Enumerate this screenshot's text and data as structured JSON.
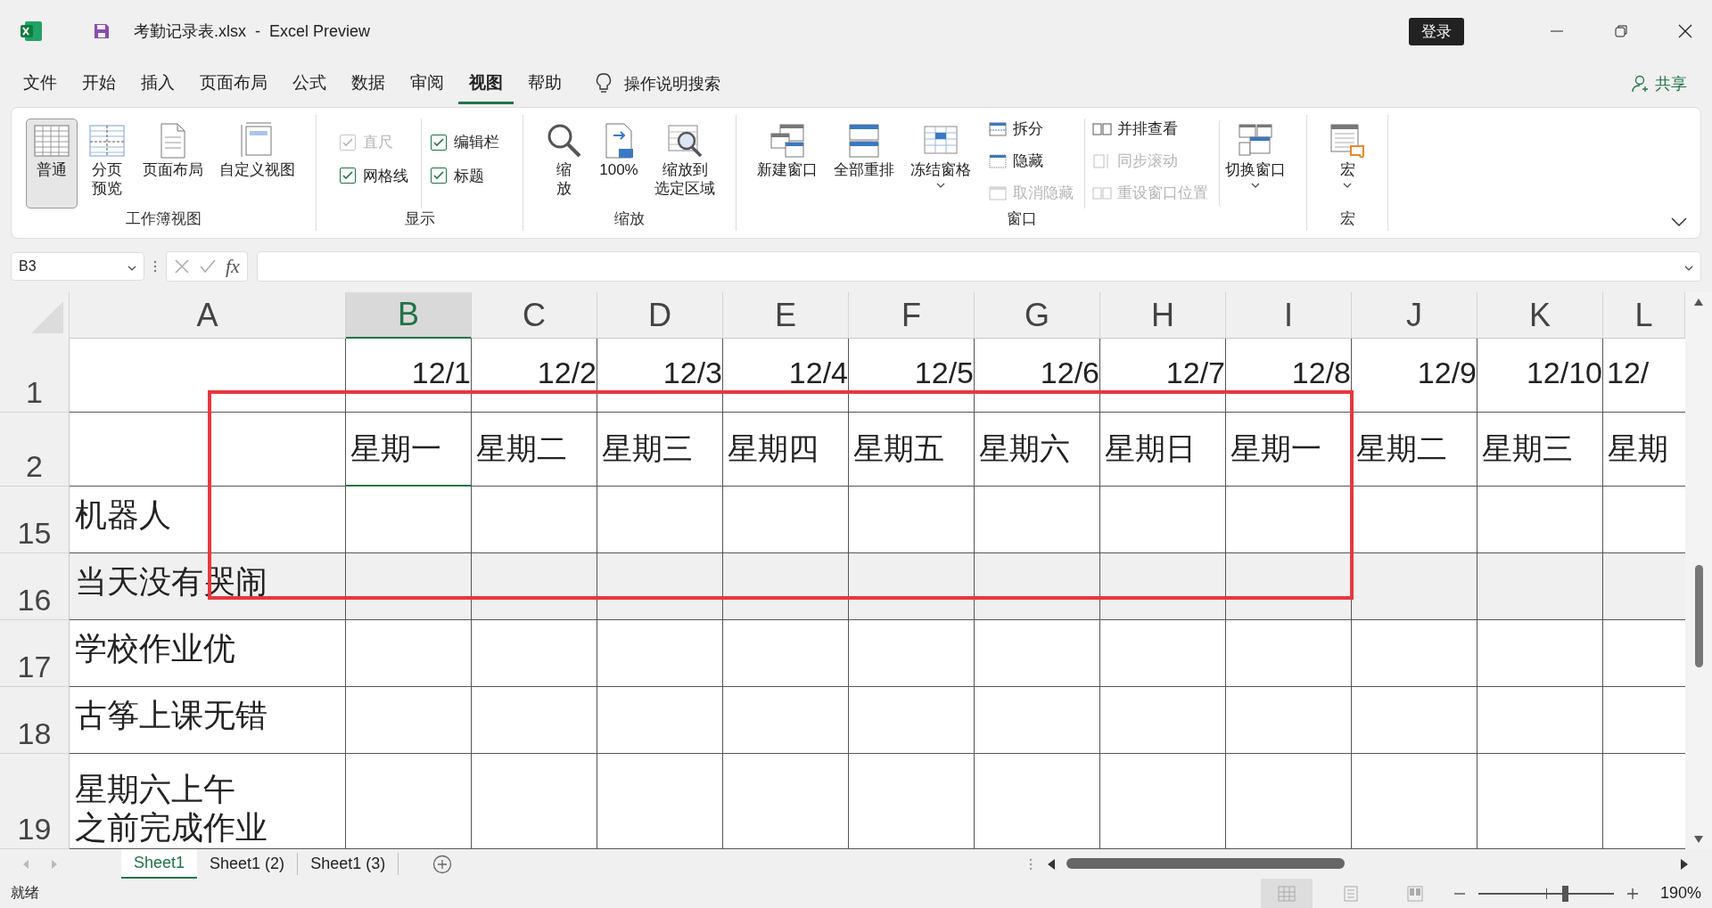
{
  "window": {
    "title": "考勤记录表.xlsx  -  Excel Preview",
    "sign_in": "登录"
  },
  "menu_tabs": [
    {
      "label": "文件",
      "selected": false
    },
    {
      "label": "开始",
      "selected": false
    },
    {
      "label": "插入",
      "selected": false
    },
    {
      "label": "页面布局",
      "selected": false
    },
    {
      "label": "公式",
      "selected": false
    },
    {
      "label": "数据",
      "selected": false
    },
    {
      "label": "审阅",
      "selected": false
    },
    {
      "label": "视图",
      "selected": true
    },
    {
      "label": "帮助",
      "selected": false
    }
  ],
  "search": {
    "placeholder": "操作说明搜索"
  },
  "share": "共享",
  "ribbon": {
    "groups": [
      {
        "label": "工作簿视图",
        "items": [
          {
            "kind": "large",
            "label": "普通",
            "selected": true
          },
          {
            "kind": "large",
            "label": "分页预览",
            "selected": false
          },
          {
            "kind": "large",
            "label": "页面布局",
            "selected": false
          },
          {
            "kind": "large",
            "label": "自定义视图",
            "selected": false
          }
        ]
      },
      {
        "label": "显示",
        "items": [
          {
            "kind": "stack",
            "items": [
              {
                "kind": "check",
                "label": "直尺",
                "checked": true,
                "disabled": true
              },
              {
                "kind": "check",
                "label": "网格线",
                "checked": true,
                "disabled": false
              }
            ]
          },
          {
            "kind": "stack",
            "items": [
              {
                "kind": "check",
                "label": "编辑栏",
                "checked": true,
                "disabled": false
              },
              {
                "kind": "check",
                "label": "标题",
                "checked": true,
                "disabled": false
              }
            ]
          }
        ]
      },
      {
        "label": "缩放",
        "items": [
          {
            "kind": "large",
            "label": "缩放"
          },
          {
            "kind": "large",
            "label": "100%"
          },
          {
            "kind": "large",
            "label": "缩放到选定区域"
          }
        ]
      },
      {
        "label": "窗口",
        "items": [
          {
            "kind": "large",
            "label": "新建窗口"
          },
          {
            "kind": "large",
            "label": "全部重排"
          },
          {
            "kind": "large",
            "label": "冻结窗格",
            "dropdown": true
          },
          {
            "kind": "stack",
            "items": [
              {
                "kind": "small",
                "label": "拆分",
                "disabled": false
              },
              {
                "kind": "small",
                "label": "隐藏",
                "disabled": false
              },
              {
                "kind": "small",
                "label": "取消隐藏",
                "disabled": true
              }
            ]
          },
          {
            "kind": "stack",
            "items": [
              {
                "kind": "small",
                "label": "并排查看",
                "disabled": false
              },
              {
                "kind": "small",
                "label": "同步滚动",
                "disabled": true
              },
              {
                "kind": "small",
                "label": "重设窗口位置",
                "disabled": true
              }
            ]
          },
          {
            "kind": "large",
            "label": "切换窗口",
            "dropdown": true
          }
        ]
      },
      {
        "label": "宏",
        "items": [
          {
            "kind": "large",
            "label": "宏",
            "dropdown": true
          }
        ]
      }
    ]
  },
  "formula_bar": {
    "name_box": "B3",
    "function_label": "fx"
  },
  "sheet": {
    "columns": [
      {
        "label": "A",
        "selected": false
      },
      {
        "label": "B",
        "selected": true
      },
      {
        "label": "C",
        "selected": false
      },
      {
        "label": "D",
        "selected": false
      },
      {
        "label": "E",
        "selected": false
      },
      {
        "label": "F",
        "selected": false
      },
      {
        "label": "G",
        "selected": false
      },
      {
        "label": "H",
        "selected": false
      },
      {
        "label": "I",
        "selected": false
      },
      {
        "label": "J",
        "selected": false
      },
      {
        "label": "K",
        "selected": false
      },
      {
        "label": "L",
        "selected": false
      }
    ],
    "rows": [
      {
        "number": "1",
        "kind": "date",
        "values": [
          "12/1",
          "12/2",
          "12/3",
          "12/4",
          "12/5",
          "12/6",
          "12/7",
          "12/8",
          "12/9",
          "12/10",
          "12/"
        ]
      },
      {
        "number": "2",
        "kind": "weekday",
        "values": [
          "星期一",
          "星期二",
          "星期三",
          "星期四",
          "星期五",
          "星期六",
          "星期日",
          "星期一",
          "星期二",
          "星期三",
          "星期"
        ]
      },
      {
        "number": "15",
        "kind": "task",
        "label": "机器人",
        "shaded": false
      },
      {
        "number": "16",
        "kind": "task",
        "label": "当天没有哭闹",
        "shaded": true
      },
      {
        "number": "17",
        "kind": "task",
        "label": "学校作业优",
        "shaded": false
      },
      {
        "number": "18",
        "kind": "task",
        "label": "古筝上课无错",
        "shaded": false
      },
      {
        "number": "19",
        "kind": "task",
        "label": "星期六上午之前完成作业",
        "shaded": false
      }
    ]
  },
  "sheet_tabs": [
    {
      "label": "Sheet1",
      "selected": true
    },
    {
      "label": "Sheet1 (2)",
      "selected": false
    },
    {
      "label": "Sheet1 (3)",
      "selected": false
    }
  ],
  "status_bar": {
    "status": "就绪",
    "views": [
      {
        "kind": "normal",
        "selected": true
      },
      {
        "kind": "page-layout",
        "selected": false
      },
      {
        "kind": "page-break",
        "selected": false
      }
    ],
    "zoom": {
      "level": 0.64,
      "reading": "190%"
    }
  }
}
